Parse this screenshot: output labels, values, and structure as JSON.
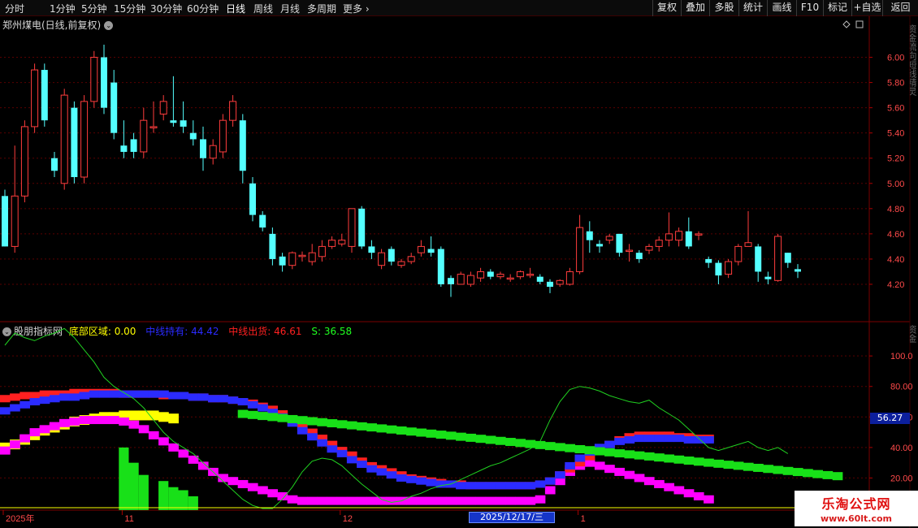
{
  "toolbar": {
    "periods": [
      "分时",
      "1分钟",
      "5分钟",
      "15分钟",
      "30分钟",
      "60分钟",
      "日线",
      "周线",
      "月线",
      "多周期",
      "更多"
    ],
    "more_arrow": "›",
    "actions": [
      "复权",
      "叠加",
      "多股",
      "统计",
      "画线",
      "F10",
      "标记",
      "+自选",
      "返回"
    ]
  },
  "main": {
    "title": "郑州煤电(日线,前复权)",
    "chevron": "⌄",
    "price_axis": [
      "6.00",
      "5.80",
      "5.60",
      "5.40",
      "5.20",
      "5.00",
      "4.80",
      "4.60",
      "4.40",
      "4.20"
    ]
  },
  "indicator": {
    "name": "股朋指标网",
    "values": [
      {
        "label": "底部区域: 0.00",
        "color": "#ffff00"
      },
      {
        "label": "中线持有: 44.42",
        "color": "#2b2bff"
      },
      {
        "label": "中线出货: 46.61",
        "color": "#ff2020"
      },
      {
        "label": "S: 36.58",
        "color": "#20ff20"
      }
    ],
    "axis": [
      "100.0",
      "80.00",
      "60.00",
      "40.00",
      "20.00"
    ],
    "current_value": "56.27"
  },
  "date_axis": {
    "labels": [
      {
        "text": "2025年",
        "idx": 0
      },
      {
        "text": "11",
        "idx": 12
      },
      {
        "text": "12",
        "idx": 34
      },
      {
        "text": "1",
        "idx": 58
      },
      {
        "text": "2",
        "idx": 80
      }
    ],
    "cursor_date": "2025/12/17/三"
  },
  "side_labels": {
    "top": "资金流向短线精灵",
    "mid": "资金"
  },
  "watermark": {
    "title": "乐淘公式网",
    "url": "www.60lt.com"
  },
  "colors": {
    "up": "#ff3d3d",
    "down": "#54ffff",
    "grid": "#5a0000",
    "axis_text": "#ff4a4a",
    "thin_line": "#20d020",
    "white_dashed": "#e8e8e8"
  },
  "chart_data": {
    "type": "candlestick",
    "price_ylim": [
      4.1,
      6.1
    ],
    "candles": [
      [
        4.9,
        4.5,
        4.95,
        4.5
      ],
      [
        4.5,
        4.9,
        5.3,
        4.45
      ],
      [
        4.9,
        5.45,
        5.5,
        4.85
      ],
      [
        5.45,
        5.9,
        5.95,
        5.4
      ],
      [
        5.9,
        5.5,
        5.95,
        5.45
      ],
      [
        5.2,
        5.1,
        5.25,
        5.05
      ],
      [
        5.0,
        5.7,
        5.75,
        4.95
      ],
      [
        5.6,
        5.05,
        5.65,
        5.0
      ],
      [
        5.05,
        5.65,
        5.7,
        5.0
      ],
      [
        5.65,
        6.0,
        6.05,
        5.6
      ],
      [
        6.0,
        5.6,
        6.1,
        5.55
      ],
      [
        5.8,
        5.4,
        5.9,
        5.35
      ],
      [
        5.3,
        5.25,
        5.5,
        5.2
      ],
      [
        5.35,
        5.25,
        5.4,
        5.2
      ],
      [
        5.25,
        5.5,
        5.6,
        5.2
      ],
      [
        5.45,
        5.45,
        5.65,
        5.4
      ],
      [
        5.55,
        5.65,
        5.7,
        5.5
      ],
      [
        5.5,
        5.48,
        5.85,
        5.45
      ],
      [
        5.5,
        5.45,
        5.65,
        5.4
      ],
      [
        5.4,
        5.35,
        5.5,
        5.3
      ],
      [
        5.35,
        5.2,
        5.45,
        5.1
      ],
      [
        5.2,
        5.3,
        5.35,
        5.15
      ],
      [
        5.25,
        5.5,
        5.55,
        5.2
      ],
      [
        5.5,
        5.65,
        5.7,
        5.45
      ],
      [
        5.5,
        5.1,
        5.55,
        5.0
      ],
      [
        5.0,
        4.75,
        5.05,
        4.7
      ],
      [
        4.75,
        4.65,
        4.78,
        4.62
      ],
      [
        4.6,
        4.4,
        4.65,
        4.35
      ],
      [
        4.42,
        4.35,
        4.45,
        4.3
      ],
      [
        4.35,
        4.45,
        4.46,
        4.32
      ],
      [
        4.42,
        4.43,
        4.46,
        4.38
      ],
      [
        4.38,
        4.45,
        4.52,
        4.35
      ],
      [
        4.42,
        4.5,
        4.55,
        4.38
      ],
      [
        4.5,
        4.55,
        4.58,
        4.48
      ],
      [
        4.52,
        4.55,
        4.6,
        4.5
      ],
      [
        4.5,
        4.8,
        4.8,
        4.45
      ],
      [
        4.8,
        4.5,
        4.82,
        4.48
      ],
      [
        4.5,
        4.45,
        4.55,
        4.4
      ],
      [
        4.35,
        4.45,
        4.48,
        4.32
      ],
      [
        4.48,
        4.38,
        4.5,
        4.35
      ],
      [
        4.35,
        4.38,
        4.4,
        4.33
      ],
      [
        4.38,
        4.42,
        4.45,
        4.36
      ],
      [
        4.45,
        4.5,
        4.55,
        4.42
      ],
      [
        4.48,
        4.45,
        4.58,
        4.42
      ],
      [
        4.48,
        4.2,
        4.5,
        4.18
      ],
      [
        4.25,
        4.2,
        4.27,
        4.1
      ],
      [
        4.2,
        4.28,
        4.3,
        4.2
      ],
      [
        4.2,
        4.27,
        4.3,
        4.18
      ],
      [
        4.25,
        4.3,
        4.33,
        4.22
      ],
      [
        4.3,
        4.26,
        4.32,
        4.24
      ],
      [
        4.26,
        4.28,
        4.3,
        4.24
      ],
      [
        4.25,
        4.25,
        4.28,
        4.22
      ],
      [
        4.26,
        4.3,
        4.31,
        4.24
      ],
      [
        4.28,
        4.28,
        4.33,
        4.25
      ],
      [
        4.26,
        4.22,
        4.28,
        4.2
      ],
      [
        4.22,
        4.18,
        4.24,
        4.13
      ],
      [
        4.2,
        4.23,
        4.24,
        4.18
      ],
      [
        4.2,
        4.3,
        4.33,
        4.19
      ],
      [
        4.3,
        4.65,
        4.75,
        4.28
      ],
      [
        4.62,
        4.55,
        4.7,
        4.45
      ],
      [
        4.52,
        4.5,
        4.55,
        4.45
      ],
      [
        4.55,
        4.58,
        4.6,
        4.52
      ],
      [
        4.6,
        4.45,
        4.6,
        4.42
      ],
      [
        4.47,
        4.47,
        4.52,
        4.38
      ],
      [
        4.45,
        4.4,
        4.47,
        4.37
      ],
      [
        4.47,
        4.5,
        4.52,
        4.44
      ],
      [
        4.5,
        4.55,
        4.58,
        4.46
      ],
      [
        4.55,
        4.6,
        4.77,
        4.5
      ],
      [
        4.55,
        4.62,
        4.65,
        4.5
      ],
      [
        4.62,
        4.5,
        4.73,
        4.48
      ],
      [
        4.6,
        4.6,
        4.62,
        4.55
      ],
      [
        4.4,
        4.37,
        4.42,
        4.33
      ],
      [
        4.37,
        4.27,
        4.39,
        4.2
      ],
      [
        4.28,
        4.38,
        4.4,
        4.25
      ],
      [
        4.38,
        4.5,
        4.52,
        4.35
      ],
      [
        4.5,
        4.53,
        4.78,
        4.5
      ],
      [
        4.5,
        4.3,
        4.52,
        4.22
      ],
      [
        4.26,
        4.24,
        4.3,
        4.2
      ],
      [
        4.23,
        4.58,
        4.6,
        4.22
      ],
      [
        4.45,
        4.37,
        4.45,
        4.33
      ],
      [
        4.32,
        4.3,
        4.36,
        4.25
      ]
    ],
    "indicator_ylim": [
      0,
      115
    ],
    "series": [
      {
        "name": "S",
        "color": "#20ff20",
        "values": [
          107,
          115,
          112,
          110,
          113,
          115,
          118,
          112,
          104,
          96,
          86,
          80,
          76,
          72,
          66,
          58,
          50,
          44,
          40,
          36,
          30,
          24,
          18,
          12,
          6,
          2,
          0,
          0,
          6,
          14,
          24,
          31,
          33,
          32,
          28,
          22,
          16,
          11,
          6,
          4,
          5,
          8,
          10,
          13,
          15,
          16,
          19,
          22,
          25,
          28,
          30,
          33,
          36,
          39,
          44,
          58,
          70,
          78,
          80,
          79,
          77,
          74,
          72,
          70,
          69,
          71,
          66,
          62,
          58,
          52,
          46,
          40,
          38,
          40,
          42,
          44,
          40,
          38,
          40,
          36
        ]
      },
      {
        "name": "中线持有",
        "color": "#2b2bff",
        "values": [
          64,
          66,
          68,
          70,
          71,
          72,
          73,
          73,
          74,
          75,
          75,
          75,
          75,
          75,
          75,
          75,
          75,
          74,
          74,
          73,
          73,
          72,
          72,
          71,
          70,
          68,
          66,
          63,
          60,
          56,
          51,
          47,
          43,
          39,
          36,
          32,
          29,
          26,
          24,
          22,
          20,
          19,
          18,
          17,
          16,
          16,
          15,
          15,
          15,
          15,
          15,
          15,
          15,
          15,
          16,
          18,
          22,
          28,
          33,
          37,
          40,
          42,
          44,
          45,
          46,
          46,
          46,
          46,
          46,
          45,
          45,
          45
        ]
      },
      {
        "name": "中线出货",
        "color": "#ff2020",
        "values": [
          72,
          73,
          74,
          74,
          75,
          75,
          75,
          76,
          76,
          76,
          76,
          76,
          75,
          75,
          75,
          75,
          74,
          74,
          74,
          73,
          73,
          72,
          72,
          71,
          70,
          69,
          67,
          65,
          62,
          58,
          54,
          50,
          46,
          42,
          38,
          35,
          31,
          28,
          26,
          24,
          22,
          20,
          19,
          18,
          17,
          16,
          16,
          15,
          15,
          15,
          15,
          15,
          15,
          15,
          16,
          18,
          22,
          26,
          30,
          34,
          38,
          42,
          45,
          47,
          48,
          48,
          48,
          48,
          47,
          47,
          46,
          46
        ]
      },
      {
        "name": "下方波动",
        "color": "#ff00ff",
        "values": [
          38,
          42,
          46,
          50,
          52,
          54,
          56,
          57,
          58,
          58,
          58,
          58,
          57,
          55,
          52,
          48,
          44,
          40,
          36,
          32,
          28,
          24,
          20,
          18,
          16,
          14,
          12,
          10,
          8,
          6,
          5,
          5,
          5,
          5,
          5,
          5,
          5,
          5,
          5,
          5,
          5,
          5,
          5,
          5,
          5,
          5,
          5,
          5,
          5,
          5,
          5,
          5,
          5,
          5,
          6,
          12,
          18,
          24,
          28,
          30,
          28,
          26,
          24,
          22,
          20,
          18,
          16,
          14,
          12,
          10,
          8,
          6
        ]
      },
      {
        "name": "黄线",
        "color": "#ffff00",
        "values": [
          40,
          42,
          45,
          48,
          51,
          53,
          55,
          57,
          58,
          59,
          60,
          60,
          61,
          61,
          61,
          61,
          60,
          59
        ]
      }
    ]
  }
}
